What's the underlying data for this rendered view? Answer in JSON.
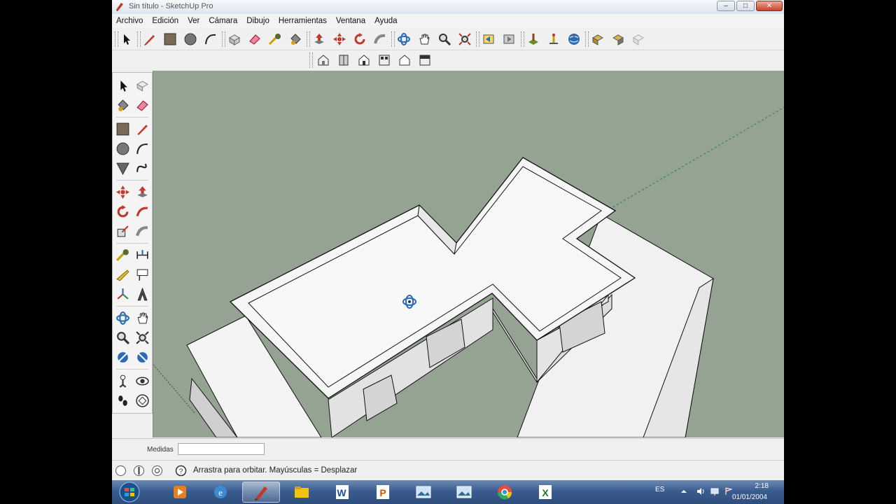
{
  "window": {
    "title": "Sin título - SketchUp Pro",
    "controls": {
      "minimize": "–",
      "maximize": "□",
      "close": "✕"
    }
  },
  "menu": [
    {
      "label": "Archivo"
    },
    {
      "label": "Edición"
    },
    {
      "label": "Ver"
    },
    {
      "label": "Cámara"
    },
    {
      "label": "Dibujo"
    },
    {
      "label": "Herramientas"
    },
    {
      "label": "Ventana"
    },
    {
      "label": "Ayuda"
    }
  ],
  "toolbar": {
    "tools": [
      "select-icon",
      "pencil-icon",
      "rectangle-icon",
      "circle-icon",
      "arc-icon",
      "make-component-icon",
      "eraser-icon",
      "tape-measure-icon",
      "paint-bucket-icon",
      "push-pull-icon",
      "move-icon",
      "rotate-icon",
      "follow-me-icon",
      "orbit-icon",
      "pan-icon",
      "zoom-icon",
      "zoom-extents-icon",
      "previous-view-icon",
      "next-view-icon",
      "add-location-icon",
      "toggle-terrain-icon",
      "get-models-icon",
      "share-model-icon",
      "share-component-icon",
      "extension-warehouse-icon",
      "photo-textures-icon"
    ]
  },
  "views_toolbar": {
    "tools": [
      "iso-view-icon",
      "top-view-icon",
      "front-view-icon",
      "right-view-icon",
      "back-view-icon",
      "left-view-icon"
    ]
  },
  "left_toolbar": {
    "tools": [
      "select-icon",
      "make-component-icon",
      "paint-bucket-icon",
      "eraser-icon",
      "rectangle-icon",
      "pencil-icon",
      "circle-icon",
      "arc-icon",
      "polygon-icon",
      "freehand-icon",
      "move-icon",
      "push-pull-icon",
      "rotate-icon",
      "follow-me-icon",
      "scale-icon",
      "offset-icon",
      "tape-measure-icon",
      "dimension-icon",
      "protractor-icon",
      "text-icon",
      "axes-icon",
      "3d-text-icon",
      "orbit-icon",
      "pan-icon",
      "zoom-icon",
      "zoom-window-icon",
      "previous-icon",
      "zoom-extents-icon",
      "position-camera-icon",
      "look-around-icon",
      "walk-icon",
      "section-plane-icon"
    ]
  },
  "measurements": {
    "label": "Medidas",
    "value": ""
  },
  "status": {
    "text": "Arrastra para orbitar.  Mayúsculas = Desplazar"
  },
  "colors": {
    "viewport_bg": "#95a393",
    "model_face": "#f4f4f4",
    "model_side": "#e2e2e2",
    "edge": "#111111",
    "taskbar": "#3b5d8e"
  },
  "taskbar": {
    "apps": [
      "start-orb-icon",
      "media-player-icon",
      "internet-explorer-icon",
      "sketchup-icon",
      "file-explorer-icon",
      "word-icon",
      "powerpoint-icon",
      "picture-viewer-icon",
      "picture-viewer-icon-2",
      "chrome-icon",
      "excel-icon"
    ],
    "tray": {
      "lang": "ES",
      "time": "2:18",
      "date": "01/01/2004"
    }
  }
}
